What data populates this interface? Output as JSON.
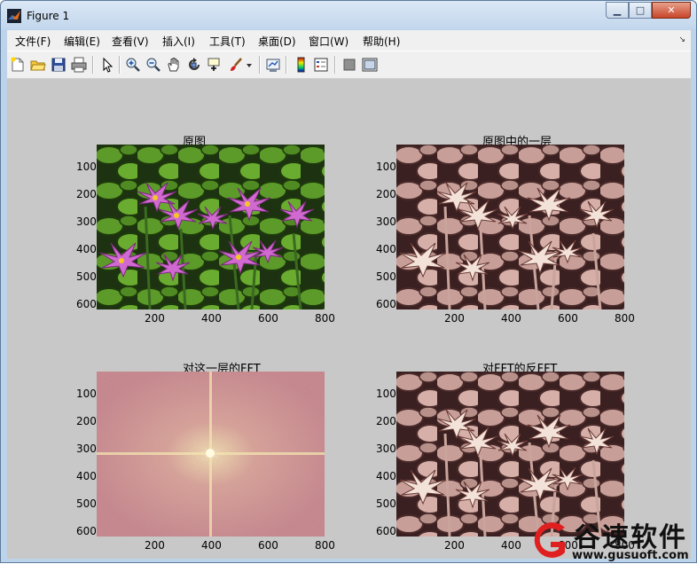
{
  "window": {
    "title": "Figure 1",
    "min_label": "▁",
    "max_label": "□",
    "close_label": "✕"
  },
  "menu": {
    "items": [
      "文件(F)",
      "编辑(E)",
      "查看(V)",
      "插入(I)",
      "工具(T)",
      "桌面(D)",
      "窗口(W)",
      "帮助(H)"
    ],
    "overflow": "↘"
  },
  "toolbar": {
    "icons": [
      "new-figure-icon",
      "open-file-icon",
      "save-icon",
      "print-icon",
      "select-arrow-icon",
      "zoom-in-icon",
      "zoom-out-icon",
      "pan-hand-icon",
      "rotate-3d-icon",
      "data-cursor-icon",
      "brush-icon",
      "dropdown-arrow-icon",
      "link-plot-icon",
      "colorbar-icon",
      "legend-icon",
      "hide-plot-tools-icon",
      "show-plot-tools-icon"
    ]
  },
  "subplots": [
    {
      "title": "原图",
      "image": "water-lily-color",
      "yticks": [
        "100",
        "200",
        "300",
        "400",
        "500",
        "600"
      ],
      "xticks": [
        "200",
        "400",
        "600",
        "800"
      ]
    },
    {
      "title": "原图中的一层",
      "image": "water-lily-single-channel",
      "yticks": [
        "100",
        "200",
        "300",
        "400",
        "500",
        "600"
      ],
      "xticks": [
        "200",
        "400",
        "600",
        "800"
      ]
    },
    {
      "title": "对这一层的FFT",
      "image": "fft-spectrum",
      "yticks": [
        "100",
        "200",
        "300",
        "400",
        "500",
        "600"
      ],
      "xticks": [
        "200",
        "400",
        "600",
        "800"
      ]
    },
    {
      "title": "对FFT的反FFT",
      "image": "inverse-fft-reconstruction",
      "yticks": [
        "100",
        "200",
        "300",
        "400",
        "500",
        "600"
      ],
      "xticks": [
        "200",
        "400",
        "600",
        "800"
      ]
    }
  ],
  "colors": {
    "figure_bg": "#c8c8c8",
    "menu_bg": "#f0f0f0",
    "watermark_red": "#e02020"
  },
  "watermark": {
    "brand": "谷速软件",
    "url": "www.gusuoft.com"
  }
}
